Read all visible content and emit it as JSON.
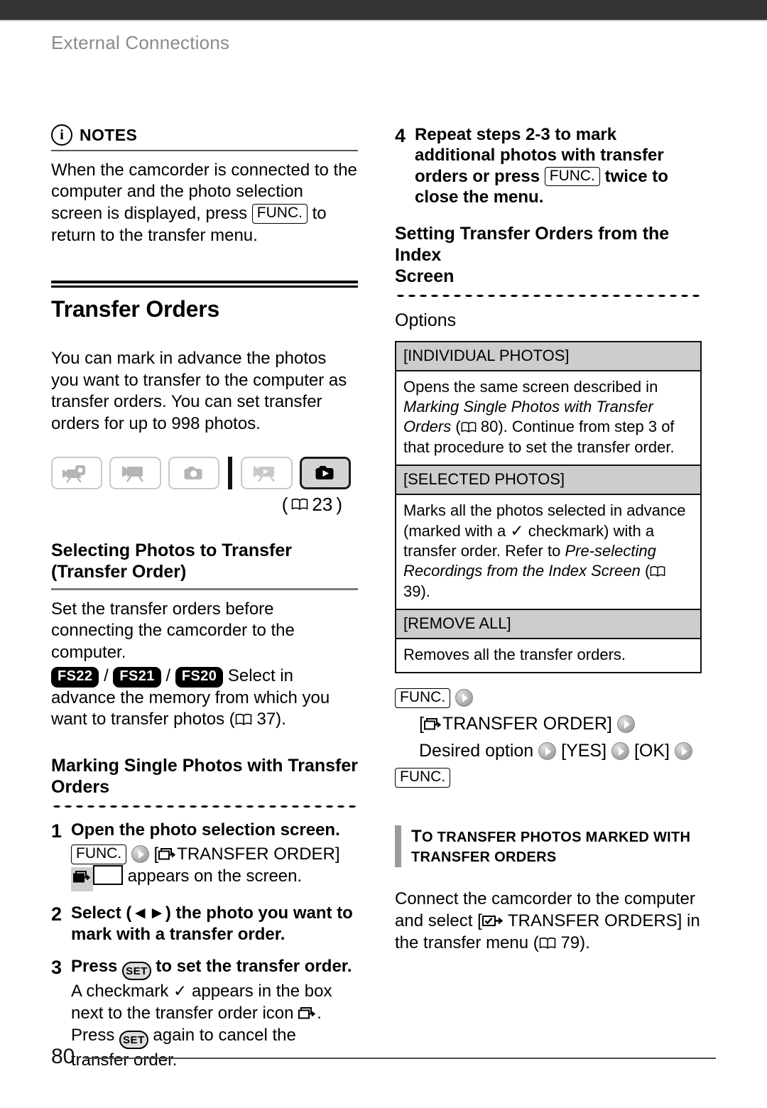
{
  "running_head": "External Connections",
  "page_number": "80",
  "notes": {
    "label": "NOTES",
    "icon": "info-icon",
    "text_1": "When the camcorder is connected to the computer and the photo selection screen is displayed, press ",
    "func_button": "FUNC.",
    "text_2": " to return to the transfer menu."
  },
  "chapter": {
    "title": "Transfer Orders",
    "intro": "You can mark in advance the photos you want to transfer to the computer as transfer orders. You can set transfer orders for up to 998 photos.",
    "mode_icons": [
      {
        "name": "dual-record-mode-icon",
        "active": false
      },
      {
        "name": "video-record-mode-icon",
        "active": false
      },
      {
        "name": "photo-record-mode-icon",
        "active": false
      },
      {
        "name": "video-playback-mode-icon",
        "active": false
      },
      {
        "name": "photo-playback-mode-icon",
        "active": true
      }
    ],
    "mode_pageref": "23"
  },
  "selecting": {
    "heading_line1": "Selecting Photos to Transfer",
    "heading_line2": "(Transfer Order)",
    "para": "Set the transfer orders before connecting the camcorder to the computer.",
    "models": [
      "FS22",
      "FS21",
      "FS20"
    ],
    "models_text": " Select in advance the memory from which you want to transfer photos (",
    "models_pageref": "37",
    "models_tail": ")."
  },
  "marking": {
    "heading_line1": "Marking Single Photos with Transfer",
    "heading_line2": "Orders",
    "steps": [
      {
        "num": "1",
        "title": "Open the photo selection screen.",
        "func": "FUNC.",
        "menu_item": "[",
        "menu_label": "TRANSFER ORDER]",
        "sub_tail": "appears on the screen."
      },
      {
        "num": "2",
        "title_a": "Select (",
        "title_arrows": "◄►",
        "title_b": ") the photo you want to mark with a transfer order."
      },
      {
        "num": "3",
        "title_a": "Press ",
        "set_button": "SET",
        "title_b": " to set the transfer order.",
        "sub_a": "A checkmark ",
        "check": "✓",
        "sub_b": " appears in the box next to the transfer order icon ",
        "sub_c": ". Press ",
        "sub_d": " again to cancel the transfer order."
      },
      {
        "num": "4",
        "title_a": "Repeat steps 2-3 to mark additional photos with transfer orders or press ",
        "func": "FUNC.",
        "title_b": " twice to close the menu."
      }
    ]
  },
  "index_screen": {
    "heading_line1": "Setting Transfer Orders from the Index",
    "heading_line2": "Screen",
    "options_label": "Options",
    "options": [
      {
        "name": "[INDIVIDUAL PHOTOS]",
        "desc_1": "Opens the same screen described in ",
        "desc_italic": "Marking Single Photos with Transfer Orders",
        "desc_2": " (",
        "pageref": "80",
        "desc_3": "). Continue from step 3 of that procedure to set the transfer order."
      },
      {
        "name": "[SELECTED PHOTOS]",
        "desc_1": "Marks all the photos selected in advance (marked with a ",
        "check": "✓",
        "desc_2": " checkmark) with a transfer order. Refer to ",
        "desc_italic": "Pre-selecting Recordings from the Index Screen",
        "desc_3": " (",
        "pageref": "39",
        "desc_4": ")."
      },
      {
        "name": "[REMOVE ALL]",
        "desc_1": "Removes all the transfer orders."
      }
    ],
    "menu_path": {
      "func_start": "FUNC.",
      "item_open": "[",
      "item_label": "TRANSFER ORDER]",
      "desired_option": "Desired option",
      "yes": "[YES]",
      "ok": "[OK]",
      "func_end": "FUNC."
    }
  },
  "to_transfer": {
    "heading_cap": "T",
    "heading_line1": "O TRANSFER PHOTOS MARKED WITH",
    "heading_line2": "TRANSFER ORDERS",
    "text_1": "Connect the camcorder to the computer and select [",
    "text_2": " TRANSFER ORDERS] in the transfer menu (",
    "pageref": "79",
    "text_3": ")."
  }
}
